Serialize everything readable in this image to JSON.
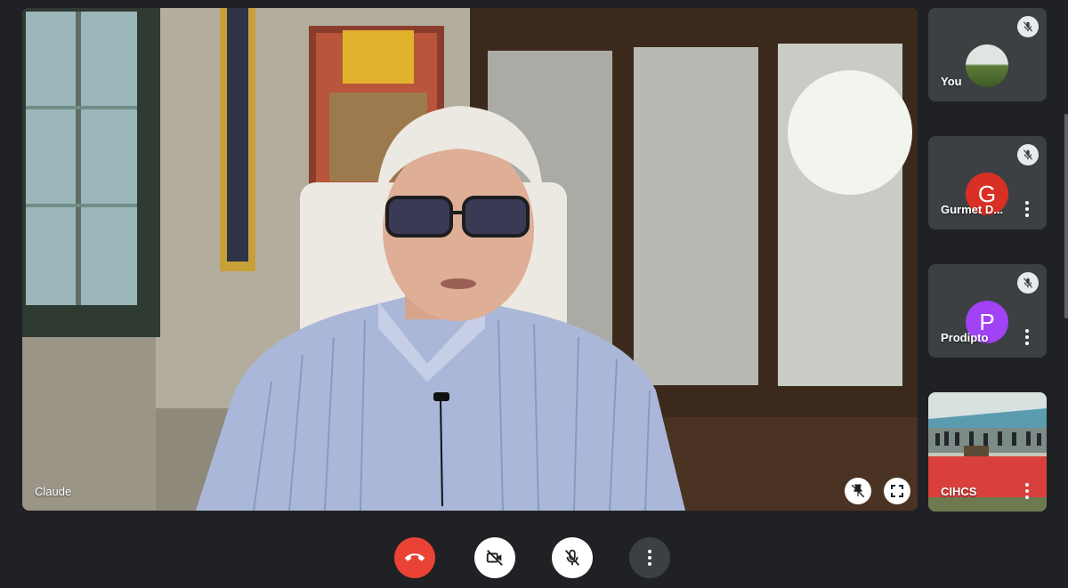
{
  "main": {
    "speaker_name": "Claude"
  },
  "participants": [
    {
      "name": "You",
      "avatar": "photo",
      "muted": true,
      "has_menu": false
    },
    {
      "name": "Gurmet D...",
      "initial": "G",
      "avatar_color": "#d93025",
      "muted": true,
      "has_menu": true
    },
    {
      "name": "Prodipto",
      "initial": "P",
      "avatar_color": "#a142f4",
      "muted": true,
      "has_menu": true
    },
    {
      "name": "CIHCS",
      "avatar": "video",
      "muted": false,
      "has_menu": true
    }
  ],
  "controls": {
    "end_call_color": "#ea4335",
    "camera_state": "off",
    "mic_state": "off"
  },
  "icons": [
    "mic-off-icon",
    "pin-icon",
    "fullscreen-icon",
    "end-call-icon",
    "camera-off-icon",
    "more-options-icon"
  ]
}
